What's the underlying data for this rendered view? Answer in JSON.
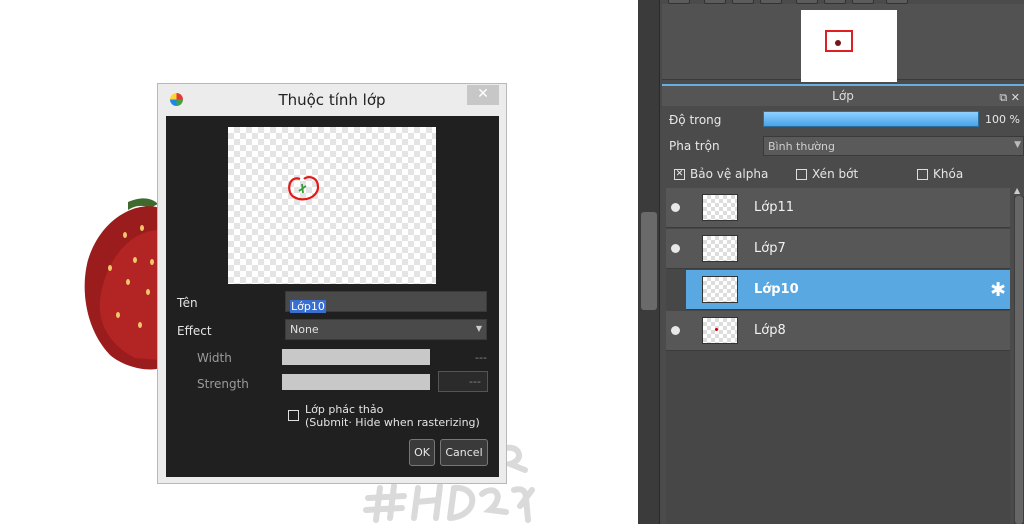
{
  "dialog": {
    "title": "Thuộc tính lớp",
    "close_glyph": "✕",
    "name_label": "Tên",
    "name_value": "Lớp10",
    "effect_label": "Effect",
    "effect_value": "None",
    "width_label": "Width",
    "width_value": "---",
    "strength_label": "Strength",
    "strength_value": "---",
    "sketch_label_line1": "Lớp phác thảo",
    "sketch_label_line2": "(Submit· Hide when rasterizing)",
    "ok_label": "OK",
    "cancel_label": "Cancel"
  },
  "layer_panel": {
    "title": "Lớp",
    "opacity_label": "Độ trong",
    "opacity_value": "100 %",
    "opacity_fraction": 1.0,
    "blend_label": "Pha trộn",
    "blend_value": "Bình thường",
    "checkboxes": [
      {
        "label": "Bảo vệ alpha",
        "checked": true
      },
      {
        "label": "Xén bớt",
        "checked": false
      },
      {
        "label": "Khóa",
        "checked": false
      }
    ],
    "layers": [
      {
        "name": "Lớp11",
        "visible": true,
        "selected": false
      },
      {
        "name": "Lớp7",
        "visible": true,
        "selected": false
      },
      {
        "name": "Lớp10",
        "visible": false,
        "selected": true
      },
      {
        "name": "Lớp8",
        "visible": true,
        "selected": false
      }
    ]
  },
  "icons": {
    "close": "close-icon",
    "gear": "gear-icon",
    "eye": "eye-icon",
    "dropdown": "chevron-down-icon",
    "app_logo": "medibang-logo-icon"
  },
  "colors": {
    "accent": "#5aa8e2",
    "opacity_bar": "#6ab8f0",
    "panel_bg": "#4b4b4b",
    "dialog_body": "#202020"
  }
}
